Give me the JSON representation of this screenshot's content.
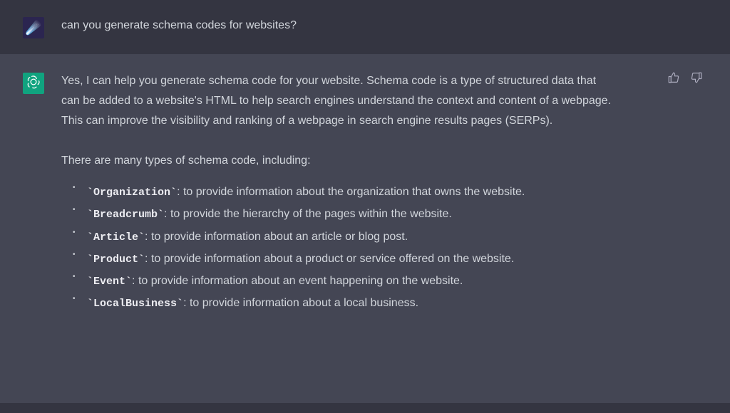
{
  "user": {
    "question": "can you generate schema codes for websites?"
  },
  "assistant": {
    "intro": "Yes, I can help you generate schema code for your website. Schema code is a type of structured data that can be added to a website's HTML to help search engines understand the context and content of a webpage. This can improve the visibility and ranking of a webpage in search engine results pages (SERPs).",
    "lead": "There are many types of schema code, including:",
    "items": [
      {
        "code": "Organization",
        "desc": ": to provide information about the organization that owns the website."
      },
      {
        "code": "Breadcrumb",
        "desc": ": to provide the hierarchy of the pages within the website."
      },
      {
        "code": "Article",
        "desc": ": to provide information about an article or blog post."
      },
      {
        "code": "Product",
        "desc": ": to provide information about a product or service offered on the website."
      },
      {
        "code": "Event",
        "desc": ": to provide information about an event happening on the website."
      },
      {
        "code": "LocalBusiness",
        "desc": ": to provide information about a local business."
      }
    ]
  },
  "icons": {
    "user_avatar_emoji": "☄️"
  }
}
